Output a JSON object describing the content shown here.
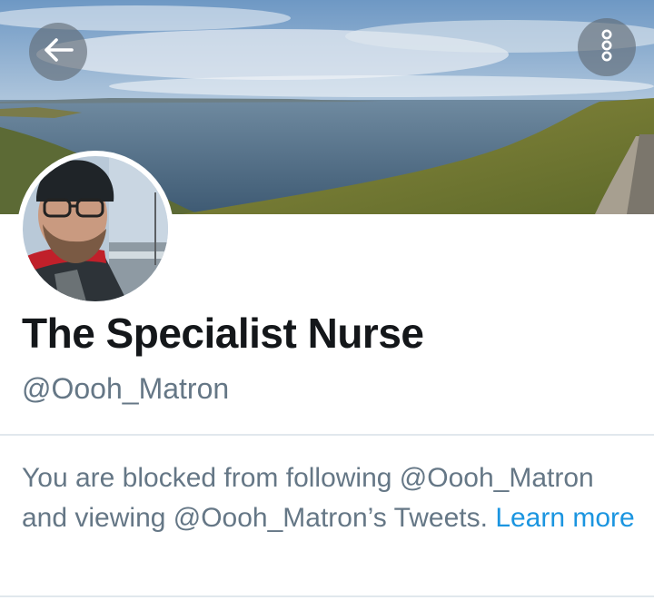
{
  "profile": {
    "display_name": "The Specialist Nurse",
    "handle": "@Oooh_Matron"
  },
  "blocked_notice": {
    "message": "You are blocked from following @Oooh_Matron and viewing @Oooh_Matron’s Tweets.",
    "learn_more_label": "Learn more"
  },
  "icons": {
    "back": "back-arrow-icon",
    "overflow": "more-vertical-icon"
  },
  "colors": {
    "name_text": "#14171a",
    "secondary_text": "#657786",
    "link": "#1b95e0",
    "divider": "#e1e8ed"
  }
}
